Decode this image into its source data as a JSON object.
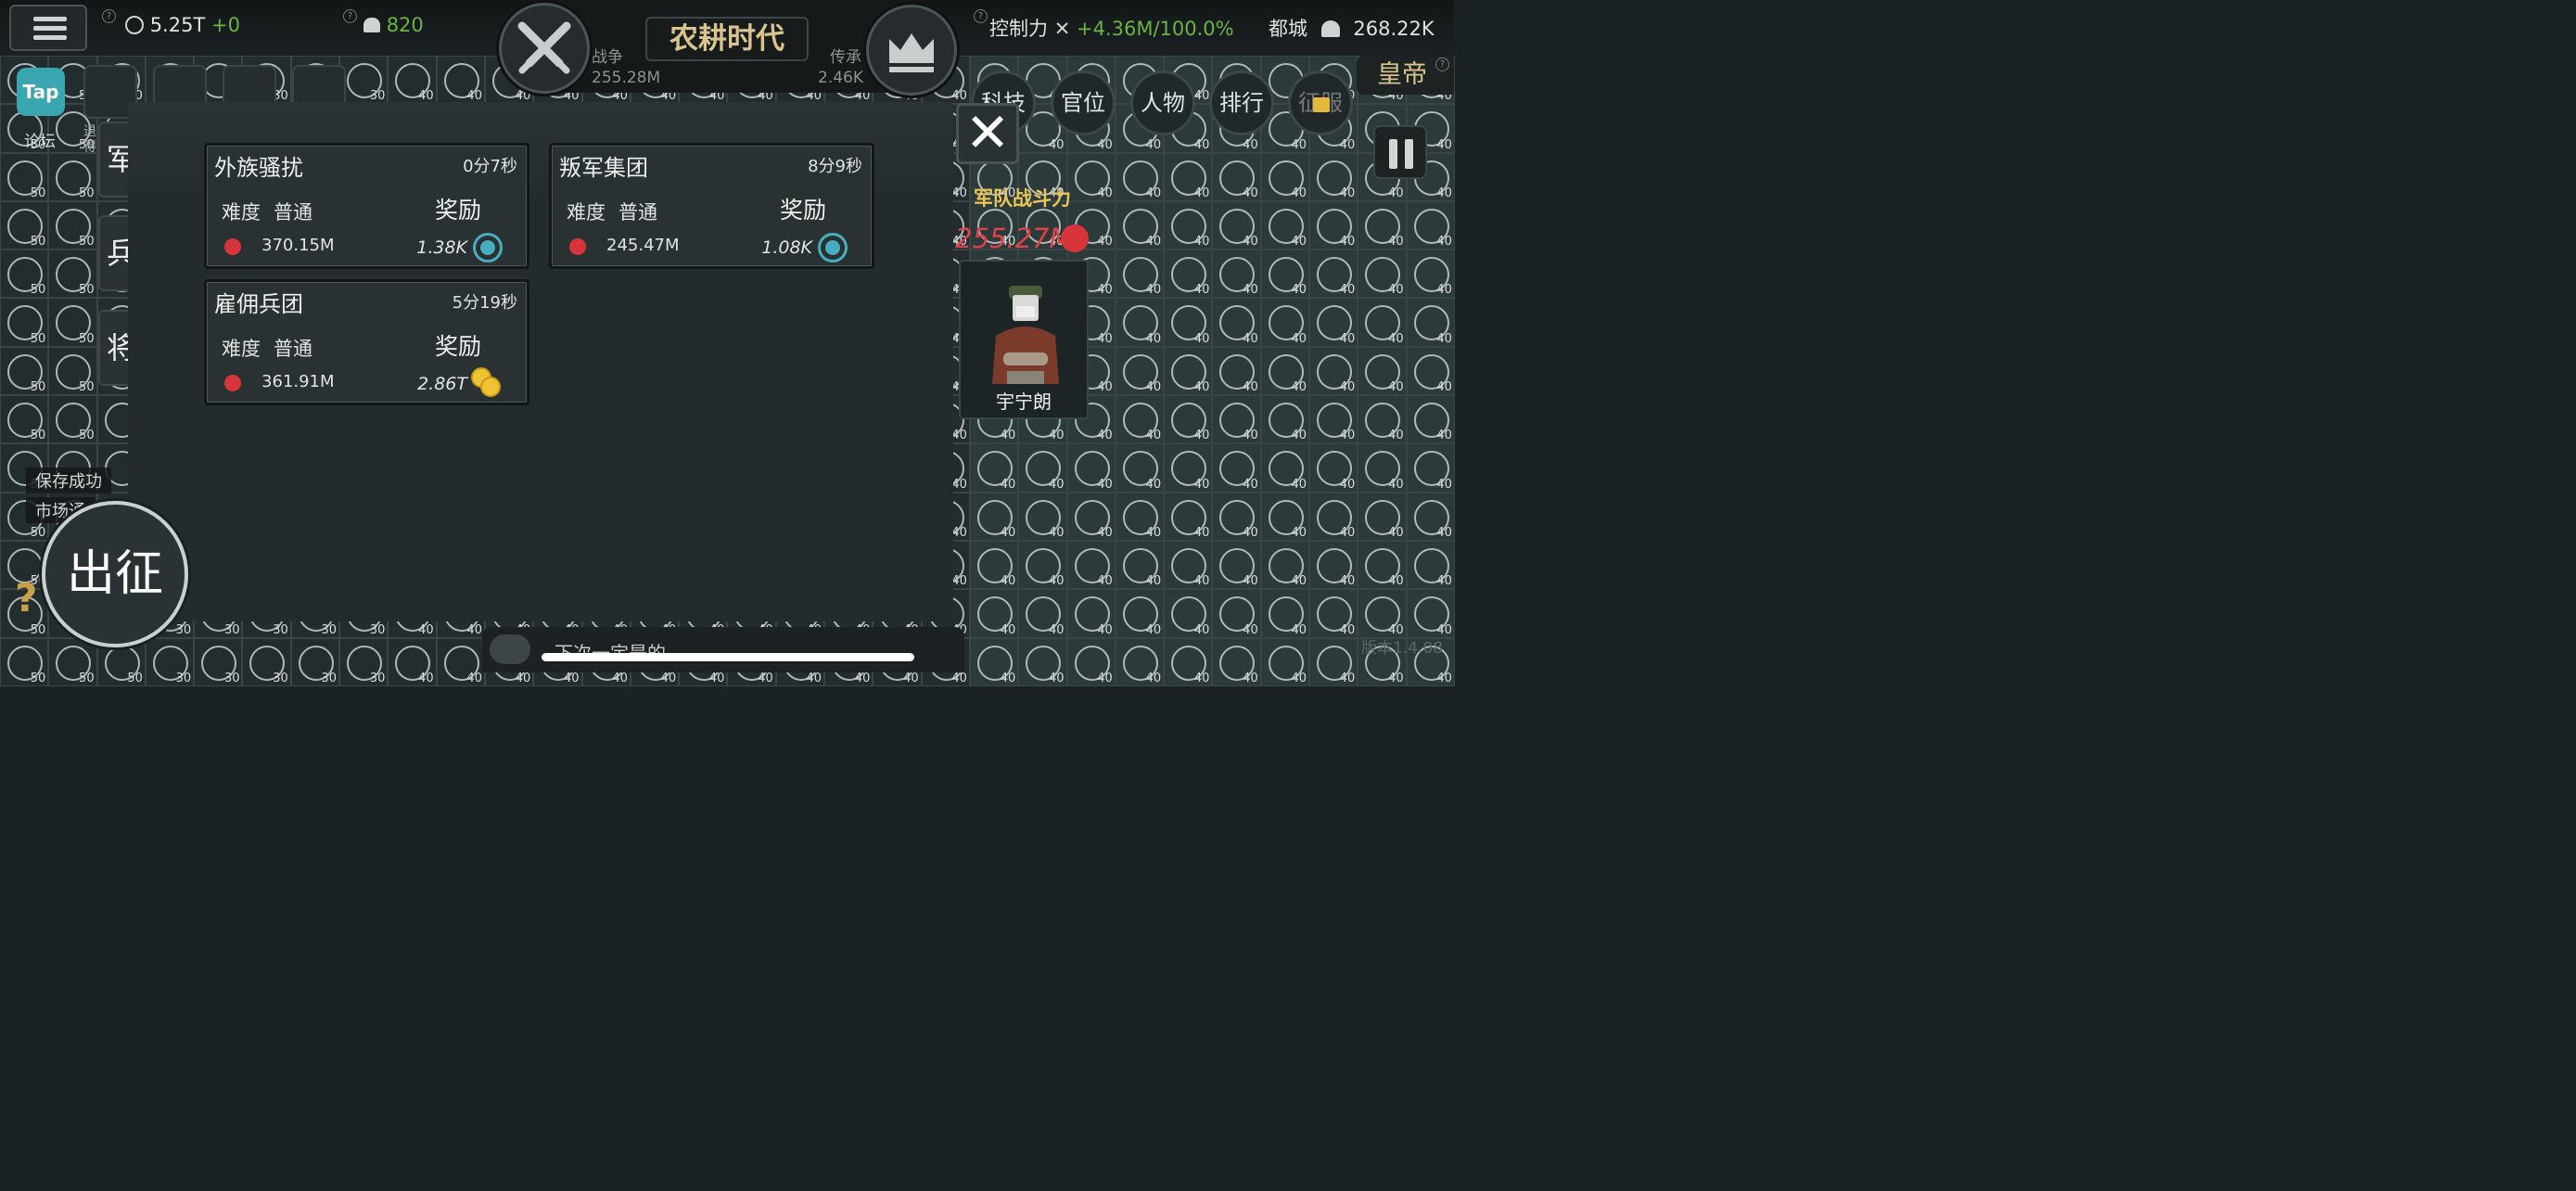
{
  "top": {
    "resource_gold": "5.25T",
    "resource_gold_delta": "+0",
    "resource_strength": "820",
    "era": "农耕时代",
    "war_label": "战争",
    "war_value": "255.28M",
    "legacy_label": "传承",
    "legacy_value": "2.46K",
    "control_label": "控制力",
    "control_rate": "+4.36M",
    "control_pct": "/100.0%",
    "capital_label": "都城",
    "capital_population": "268.22K"
  },
  "nav": {
    "tech": "科技",
    "office": "官位",
    "people": "人物",
    "rank": "排行",
    "conquer": "征服",
    "title_badge": "皇帝"
  },
  "toolbar": {
    "tap": "Tap",
    "forum": "论坛",
    "exit": "退得"
  },
  "side_tabs": [
    "军队",
    "兵种",
    "将军"
  ],
  "missions": [
    {
      "title": "外族骚扰",
      "time": "0分7秒",
      "difficulty_label": "难度",
      "difficulty": "普通",
      "reward_label": "奖励",
      "power": "370.15M",
      "reward": "1.38K",
      "reward_icon": "crown-coin"
    },
    {
      "title": "叛军集团",
      "time": "8分9秒",
      "difficulty_label": "难度",
      "difficulty": "普通",
      "reward_label": "奖励",
      "power": "245.47M",
      "reward": "1.08K",
      "reward_icon": "crown-coin"
    },
    {
      "title": "雇佣兵团",
      "time": "5分19秒",
      "difficulty_label": "难度",
      "difficulty": "普通",
      "reward_label": "奖励",
      "power": "361.91M",
      "reward": "2.86T",
      "reward_icon": "gold-coins"
    }
  ],
  "army": {
    "power_title": "军队战斗力",
    "power_value": "255.27M",
    "general_name": "宇宁朗"
  },
  "actions": {
    "march": "出征",
    "help": "?"
  },
  "toasts": [
    "保存成功",
    "市场通"
  ],
  "chat": {
    "preview": "下次一定是的"
  },
  "watermark": "版本1.4.08",
  "colors": {
    "accent_gold": "#d8c48e",
    "danger_red": "#d5353b",
    "teal": "#47aec0",
    "green": "#6db344"
  }
}
